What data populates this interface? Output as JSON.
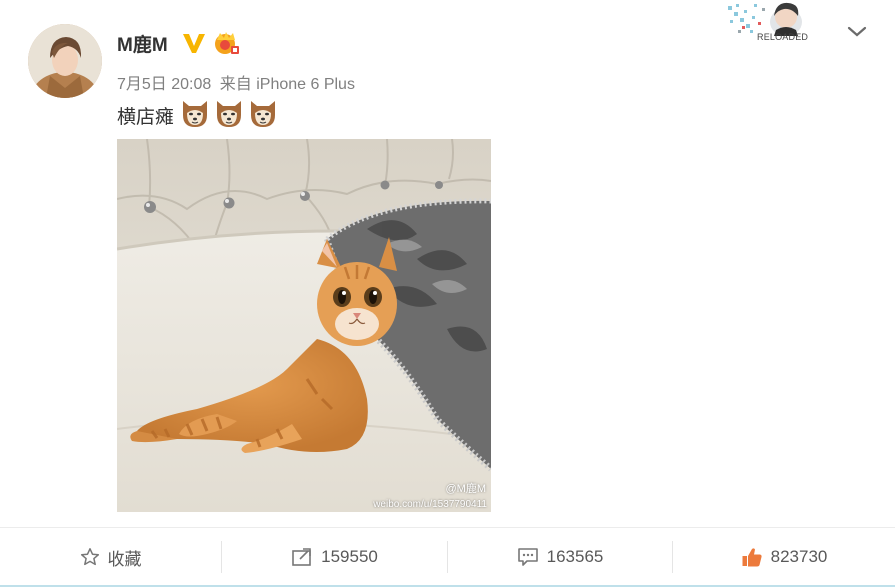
{
  "post": {
    "username": "M鹿M",
    "time": "7月5日 20:08",
    "source_prefix": "来自",
    "source": "iPhone 6 Plus",
    "text": "横店瘫",
    "emoji": [
      "doge-cat-emoji",
      "doge-cat-emoji",
      "doge-cat-emoji"
    ]
  },
  "decoration": {
    "label": "RELOADED"
  },
  "image": {
    "watermark_handle": "@M鹿M",
    "watermark_url": "weibo.com/u/1537790411"
  },
  "toolbar": {
    "favorite_label": "收藏",
    "repost_count": "159550",
    "comment_count": "163565",
    "like_count": "823730"
  },
  "colors": {
    "text_primary": "#333333",
    "text_meta": "#808080",
    "verified_gold": "#f7b500",
    "like_orange": "#ec7a3c",
    "toolbar_text": "#595959"
  },
  "icons": [
    "avatar",
    "verified-v-icon",
    "vip-crown-icon",
    "chevron-down-icon",
    "star-icon",
    "repost-icon",
    "comment-icon",
    "thumbs-up-icon"
  ]
}
